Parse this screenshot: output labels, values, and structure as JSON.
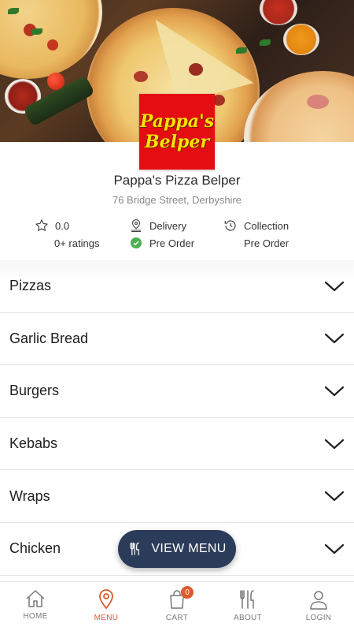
{
  "restaurant": {
    "logo_line1": "Pappa's",
    "logo_line2": "Belper",
    "name": "Pappa's Pizza Belper",
    "address": "76 Bridge Street, Derbyshire"
  },
  "info": {
    "rating_value": "0.0",
    "rating_count": "0+ ratings",
    "delivery_label": "Delivery",
    "delivery_status": "Pre Order",
    "collection_label": "Collection",
    "collection_status": "Pre Order"
  },
  "categories": [
    "Pizzas",
    "Garlic Bread",
    "Burgers",
    "Kebabs",
    "Wraps",
    "Chicken"
  ],
  "view_menu_label": "VIEW MENU",
  "nav": {
    "items": [
      {
        "label": "HOME",
        "icon": "home-icon"
      },
      {
        "label": "MENU",
        "icon": "map-pin-icon"
      },
      {
        "label": "CART",
        "icon": "shopping-bag-icon"
      },
      {
        "label": "ABOUT",
        "icon": "cutlery-icon"
      },
      {
        "label": "LOGIN",
        "icon": "user-icon"
      }
    ],
    "active": "MENU",
    "cart_count": "0"
  },
  "colors": {
    "accent": "#e05a2b",
    "button": "#2b3b5a",
    "logo_bg": "#e60d12",
    "logo_text": "#ffe000",
    "success": "#4caf50"
  }
}
